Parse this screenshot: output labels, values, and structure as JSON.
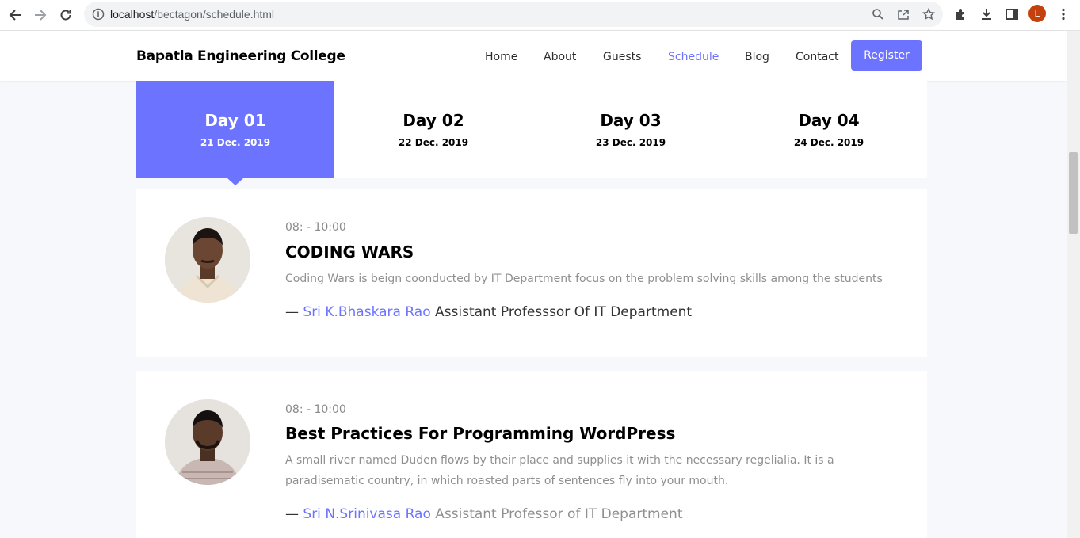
{
  "browser": {
    "url_host": "localhost",
    "url_path": "/bectagon/schedule.html",
    "profile_initial": "L"
  },
  "header": {
    "brand": "Bapatla Engineering College",
    "menu": [
      "Home",
      "About",
      "Guests",
      "Schedule",
      "Blog",
      "Contact"
    ],
    "active_menu": "Schedule",
    "register_label": "Register"
  },
  "tabs": [
    {
      "title": "Day 01",
      "date": "21 Dec. 2019"
    },
    {
      "title": "Day 02",
      "date": "22 Dec. 2019"
    },
    {
      "title": "Day 03",
      "date": "23 Dec. 2019"
    },
    {
      "title": "Day 04",
      "date": "24 Dec. 2019"
    }
  ],
  "sessions": [
    {
      "time": "08: - 10:00",
      "title": "CODING WARS",
      "description": "Coding Wars is beign coonducted by IT Department focus on the problem solving skills among the students",
      "dash": "—",
      "speaker": "Sri K.Bhaskara Rao",
      "role": "Assistant Professsor Of IT Department"
    },
    {
      "time": "08: - 10:00",
      "title": "Best Practices For Programming WordPress",
      "description": "A small river named Duden flows by their place and supplies it with the necessary regelialia. It is a paradisematic country, in which roasted parts of sentences fly into your mouth.",
      "dash": "—",
      "speaker": "Sri N.Srinivasa Rao",
      "role": "Assistant Professor of IT Department"
    }
  ],
  "colors": {
    "accent": "#6c73ff",
    "text": "#000000",
    "muted": "#8f8f8f"
  }
}
